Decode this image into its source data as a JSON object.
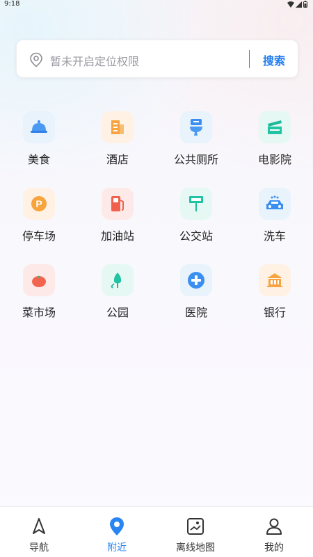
{
  "status_bar": {
    "time": "9:18"
  },
  "search": {
    "placeholder": "暂未开启定位权限",
    "button_label": "搜索"
  },
  "categories": [
    {
      "label": "美食",
      "icon": "food-cloche-icon"
    },
    {
      "label": "酒店",
      "icon": "hotel-building-icon"
    },
    {
      "label": "公共厕所",
      "icon": "toilet-icon"
    },
    {
      "label": "电影院",
      "icon": "clapperboard-icon"
    },
    {
      "label": "停车场",
      "icon": "parking-icon"
    },
    {
      "label": "加油站",
      "icon": "fuel-pump-icon"
    },
    {
      "label": "公交站",
      "icon": "bus-stop-icon"
    },
    {
      "label": "洗车",
      "icon": "car-wash-icon"
    },
    {
      "label": "菜市场",
      "icon": "tomato-icon"
    },
    {
      "label": "公园",
      "icon": "tree-icon"
    },
    {
      "label": "医院",
      "icon": "hospital-cross-icon"
    },
    {
      "label": "银行",
      "icon": "bank-icon"
    }
  ],
  "bottom_nav": [
    {
      "label": "导航",
      "active": false
    },
    {
      "label": "附近",
      "active": true
    },
    {
      "label": "离线地图",
      "active": false
    },
    {
      "label": "我的",
      "active": false
    }
  ],
  "colors": {
    "accent": "#2a85f3"
  }
}
